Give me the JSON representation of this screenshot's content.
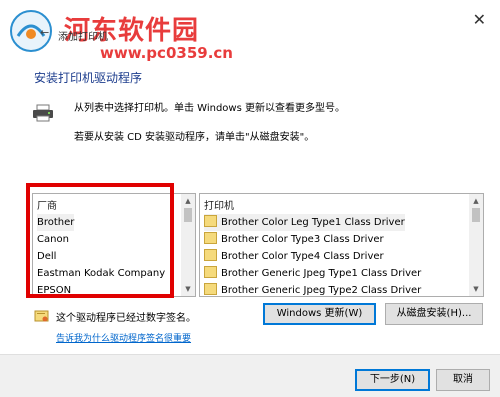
{
  "watermark": {
    "site_name": "河东软件园",
    "url": "www.pc0359.cn"
  },
  "window": {
    "title": "添加打印机",
    "close_glyph": "✕",
    "back_glyph": "←"
  },
  "heading": "安装打印机驱动程序",
  "instructions": {
    "line1": "从列表中选择打印机。单击 Windows 更新以查看更多型号。",
    "line2": "若要从安装 CD 安装驱动程序，请单击\"从磁盘安装\"。"
  },
  "manufacturers": {
    "header": "厂商",
    "items": [
      "Brother",
      "Canon",
      "Dell",
      "Eastman Kodak Company",
      "EPSON"
    ],
    "selected_index": 0
  },
  "printers": {
    "header": "打印机",
    "items": [
      "Brother Color Leg Type1 Class Driver",
      "Brother Color Type3 Class Driver",
      "Brother Color Type4 Class Driver",
      "Brother Generic Jpeg Type1 Class Driver",
      "Brother Generic Jpeg Type2 Class Driver"
    ],
    "selected_index": 0
  },
  "buttons": {
    "windows_update": "Windows 更新(W)",
    "have_disk": "从磁盘安装(H)...",
    "next": "下一步(N)",
    "cancel": "取消"
  },
  "signature": {
    "status": "这个驱动程序已经过数字签名。",
    "link": "告诉我为什么驱动程序签名很重要"
  },
  "colors": {
    "heading": "#1e3e8e",
    "link": "#0066cc",
    "highlight": "#e00000",
    "watermark": "#e83c3c"
  }
}
